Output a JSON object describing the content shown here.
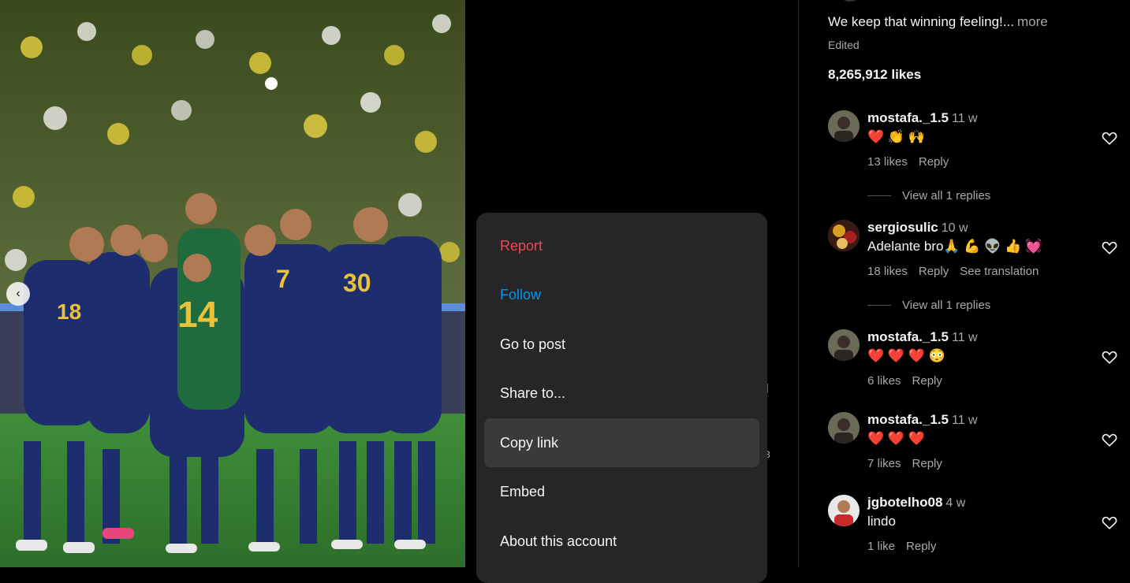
{
  "post": {
    "caption": "We keep that winning feeling!...",
    "caption_more": "more",
    "edited": "Edited",
    "likes": "8,265,912 likes",
    "jersey_numbers": [
      "14",
      "7",
      "30",
      "18"
    ]
  },
  "menu": {
    "items": [
      {
        "label": "Report",
        "color": "#ed4956"
      },
      {
        "label": "Follow",
        "color": "#0095f6"
      },
      {
        "label": "Go to post"
      },
      {
        "label": "Share to..."
      },
      {
        "label": "Copy link",
        "hovered": true
      },
      {
        "label": "Embed"
      },
      {
        "label": "About this account"
      }
    ]
  },
  "comments": [
    {
      "user": "mostafa._1.5",
      "time": "11 w",
      "text": "❤️ 👏 🙌",
      "likes": "13 likes",
      "reply": "Reply",
      "view_replies": "View all 1 replies"
    },
    {
      "user": "sergiosulic",
      "time": "10 w",
      "text": "Adelante bro🙏 💪 👽 👍 💓",
      "likes": "18 likes",
      "reply": "Reply",
      "translation": "See translation",
      "view_replies": "View all 1 replies"
    },
    {
      "user": "mostafa._1.5",
      "time": "11 w",
      "text": "❤️ ❤️ ❤️ 😳",
      "likes": "6 likes",
      "reply": "Reply"
    },
    {
      "user": "mostafa._1.5",
      "time": "11 w",
      "text": "❤️ ❤️ ❤️",
      "likes": "7 likes",
      "reply": "Reply"
    },
    {
      "user": "jgbotelho08",
      "time": "4 w",
      "text": "lindo",
      "likes": "1 like",
      "reply": "Reply"
    }
  ],
  "colors": {
    "accent_blue": "#0095f6",
    "danger_red": "#ed4956",
    "panel_bg": "#000000",
    "menu_bg": "#262626"
  }
}
